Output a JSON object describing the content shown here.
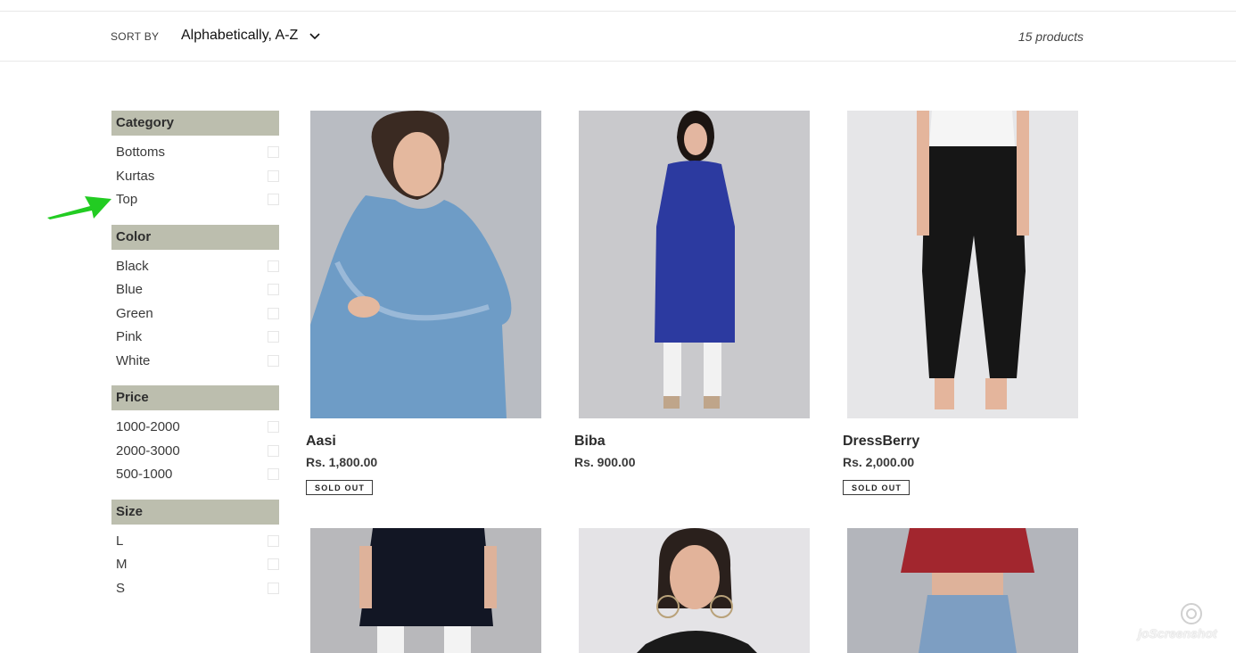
{
  "toolbar": {
    "sort_label": "SORT BY",
    "sort_value": "Alphabetically, A-Z",
    "product_count": "15 products"
  },
  "filters": [
    {
      "title": "Category",
      "options": [
        "Bottoms",
        "Kurtas",
        "Top"
      ]
    },
    {
      "title": "Color",
      "options": [
        "Black",
        "Blue",
        "Green",
        "Pink",
        "White"
      ]
    },
    {
      "title": "Price",
      "options": [
        "1000-2000",
        "2000-3000",
        "500-1000"
      ]
    },
    {
      "title": "Size",
      "options": [
        "L",
        "M",
        "S"
      ]
    }
  ],
  "products": [
    {
      "name": "Aasi",
      "price": "Rs. 1,800.00",
      "badge": "SOLD OUT"
    },
    {
      "name": "Biba",
      "price": "Rs. 900.00",
      "badge": ""
    },
    {
      "name": "DressBerry",
      "price": "Rs. 2,000.00",
      "badge": "SOLD OUT"
    }
  ],
  "colors": {
    "facet_header_bg": "#bcbeae",
    "annotation_arrow": "#22cc22"
  },
  "watermark": {
    "text": "joScreenshot"
  }
}
